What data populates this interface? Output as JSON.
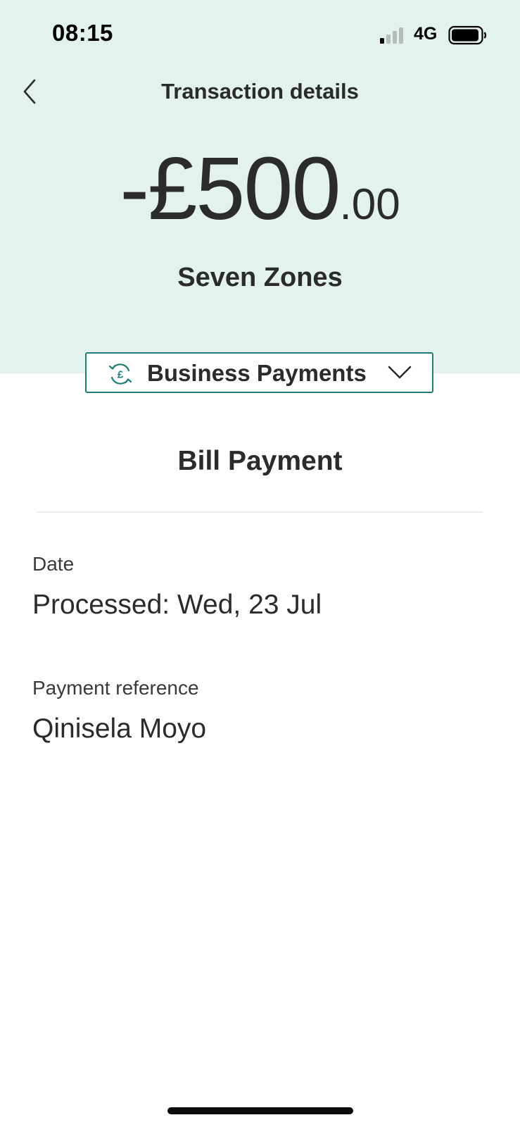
{
  "status_bar": {
    "time": "08:15",
    "network": "4G"
  },
  "nav": {
    "title": "Transaction details",
    "back_icon": "chevron-left-icon"
  },
  "transaction": {
    "amount_main": "-£500",
    "amount_decimal": ".00",
    "merchant": "Seven Zones",
    "category": "Business Payments",
    "type": "Bill Payment"
  },
  "details": {
    "date_label": "Date",
    "date_value": "Processed: Wed, 23 Jul",
    "reference_label": "Payment reference",
    "reference_value": "Qinisela Moyo"
  },
  "colors": {
    "header_bg": "#e3f1ef",
    "accent": "#1f7e7a",
    "text": "#2b2b2b"
  }
}
